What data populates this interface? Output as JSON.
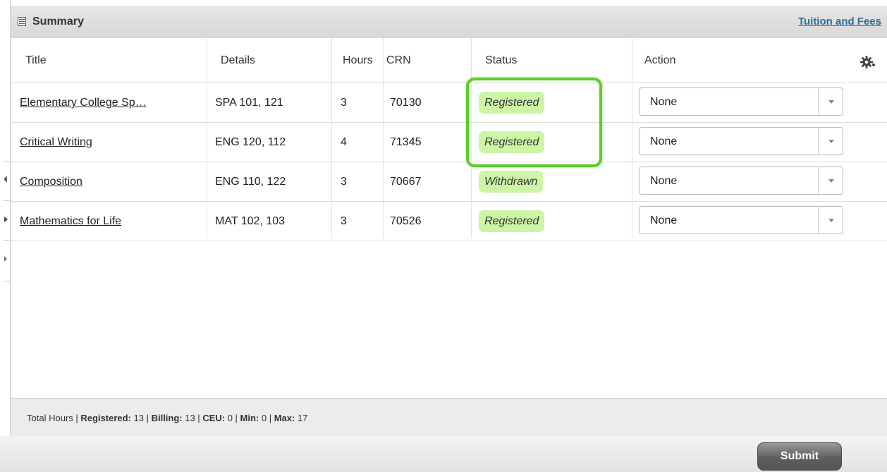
{
  "header": {
    "title": "Summary",
    "link": "Tuition and Fees"
  },
  "columns": {
    "title": "Title",
    "details": "Details",
    "hours": "Hours",
    "crn": "CRN",
    "status": "Status",
    "action": "Action"
  },
  "rows": [
    {
      "title": "Elementary College Sp…",
      "details": "SPA 101, 121",
      "hours": "3",
      "crn": "70130",
      "status": "Registered",
      "action": "None"
    },
    {
      "title": "Critical Writing",
      "details": "ENG 120, 112",
      "hours": "4",
      "crn": "71345",
      "status": "Registered",
      "action": "None"
    },
    {
      "title": "Composition",
      "details": "ENG 110, 122",
      "hours": "3",
      "crn": "70667",
      "status": "Withdrawn",
      "action": "None"
    },
    {
      "title": "Mathematics for Life",
      "details": "MAT 102, 103",
      "hours": "3",
      "crn": "70526",
      "status": "Registered",
      "action": "None"
    }
  ],
  "footer": {
    "prefix": "Total Hours | ",
    "registered_label": "Registered:",
    "registered_value": " 13 | ",
    "billing_label": "Billing:",
    "billing_value": " 13 | ",
    "ceu_label": "CEU:",
    "ceu_value": " 0 | ",
    "min_label": "Min:",
    "min_value": " 0 | ",
    "max_label": "Max:",
    "max_value": " 17"
  },
  "submit_label": "Submit",
  "icons": {
    "header": "table-icon",
    "settings": "gear-icon",
    "dropdown": "chevron-down-icon"
  },
  "colors": {
    "status_badge": "#cdf5a6",
    "highlight": "#5ccc2a",
    "link": "#2f6f9d"
  }
}
